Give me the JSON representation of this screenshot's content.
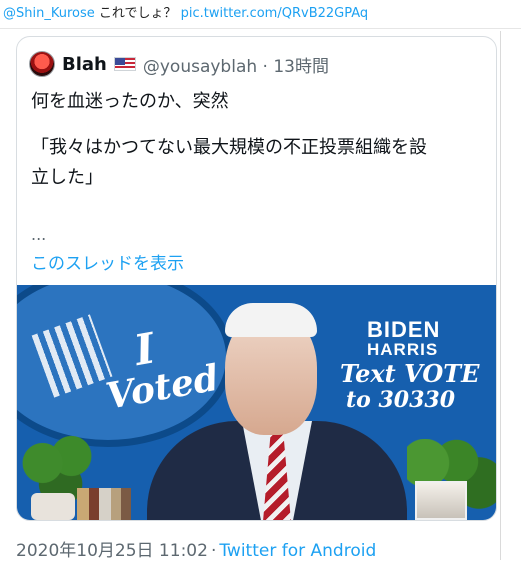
{
  "header_line": {
    "username": "@Shin_Kurose",
    "text": " これでしょ？ ",
    "link": "pic.twitter.com/QRvB22GPAq"
  },
  "quoted_tweet": {
    "display_name": "Blah",
    "handle_time": "@yousayblah · 13時間",
    "lines": [
      "何を血迷ったのか、突然",
      "「我々はかつてない最大規模の不正投票組織を設",
      "立した」"
    ],
    "ellipsis": "...",
    "show_thread": "このスレッドを表示"
  },
  "media": {
    "voted_line1": "I",
    "voted_line2": "Voted",
    "biden": "BIDEN",
    "harris": "HARRIS",
    "text_vote": "Text VOTE",
    "to_number": "to 30330"
  },
  "footer": {
    "timestamp": "2020年10月25日 11:02",
    "separator": "·",
    "source": "Twitter for Android"
  },
  "colors": {
    "link": "#1da1f2",
    "muted": "#5d6870",
    "media_bg": "#165fae"
  }
}
